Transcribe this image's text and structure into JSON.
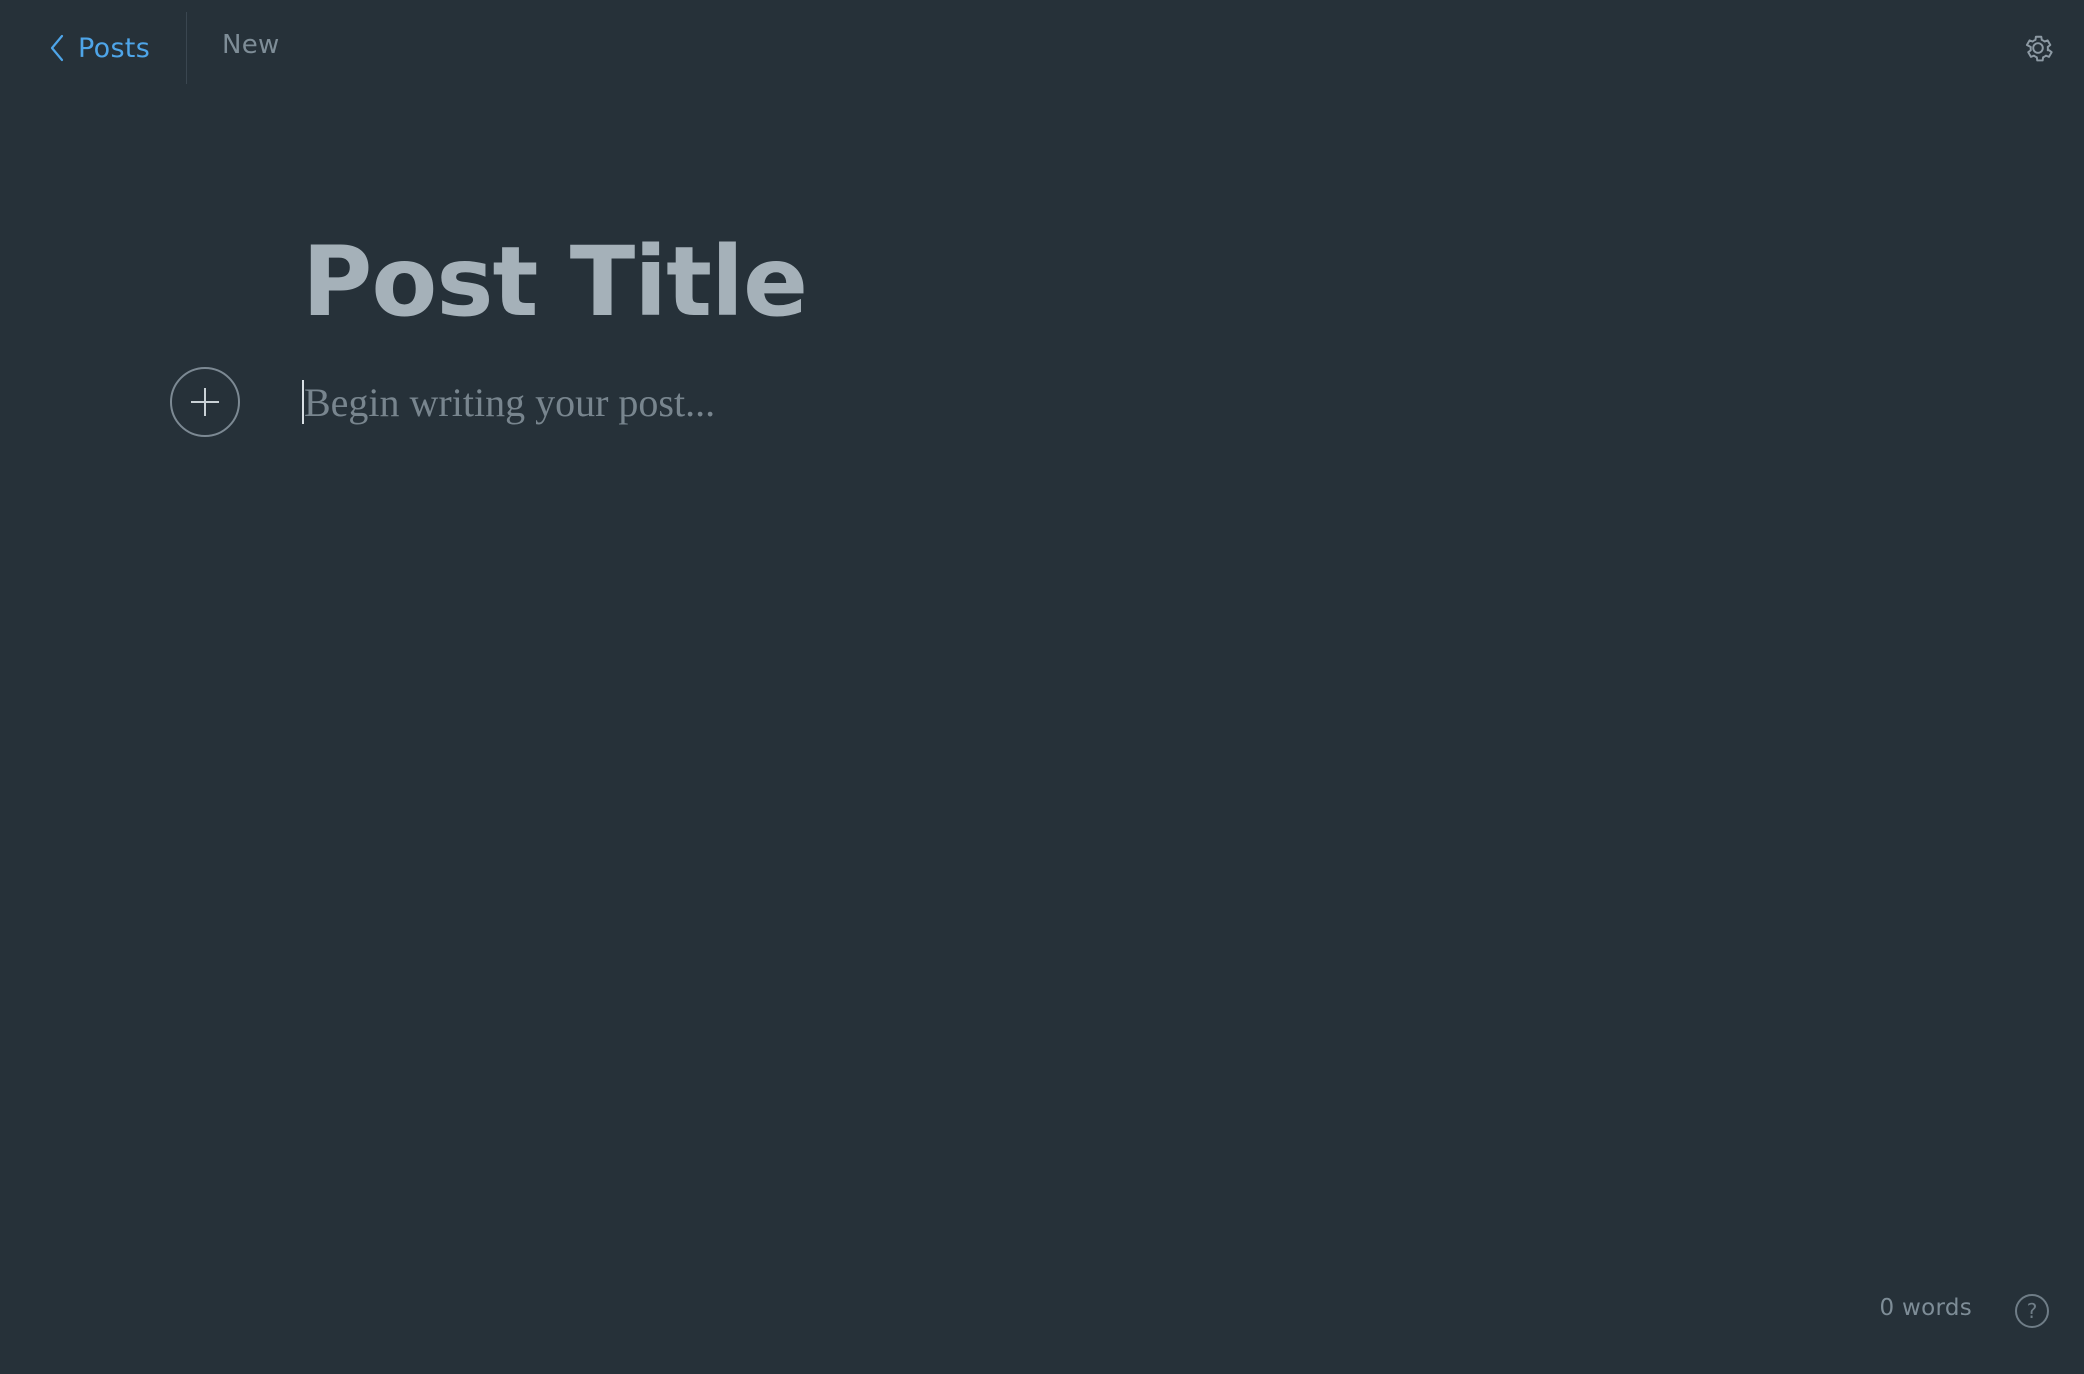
{
  "header": {
    "back_label": "Posts",
    "status": "New",
    "back_icon": "chevron-left-icon",
    "settings_icon": "gear-icon"
  },
  "editor": {
    "title_placeholder": "Post Title",
    "body_placeholder": "Begin writing your post...",
    "add_icon": "plus-icon"
  },
  "footer": {
    "word_count": "0 words",
    "help_glyph": "?"
  },
  "colors": {
    "background": "#263139",
    "accent": "#4ea5e9",
    "title": "#a5b1b9",
    "muted": "#7e8d97"
  }
}
